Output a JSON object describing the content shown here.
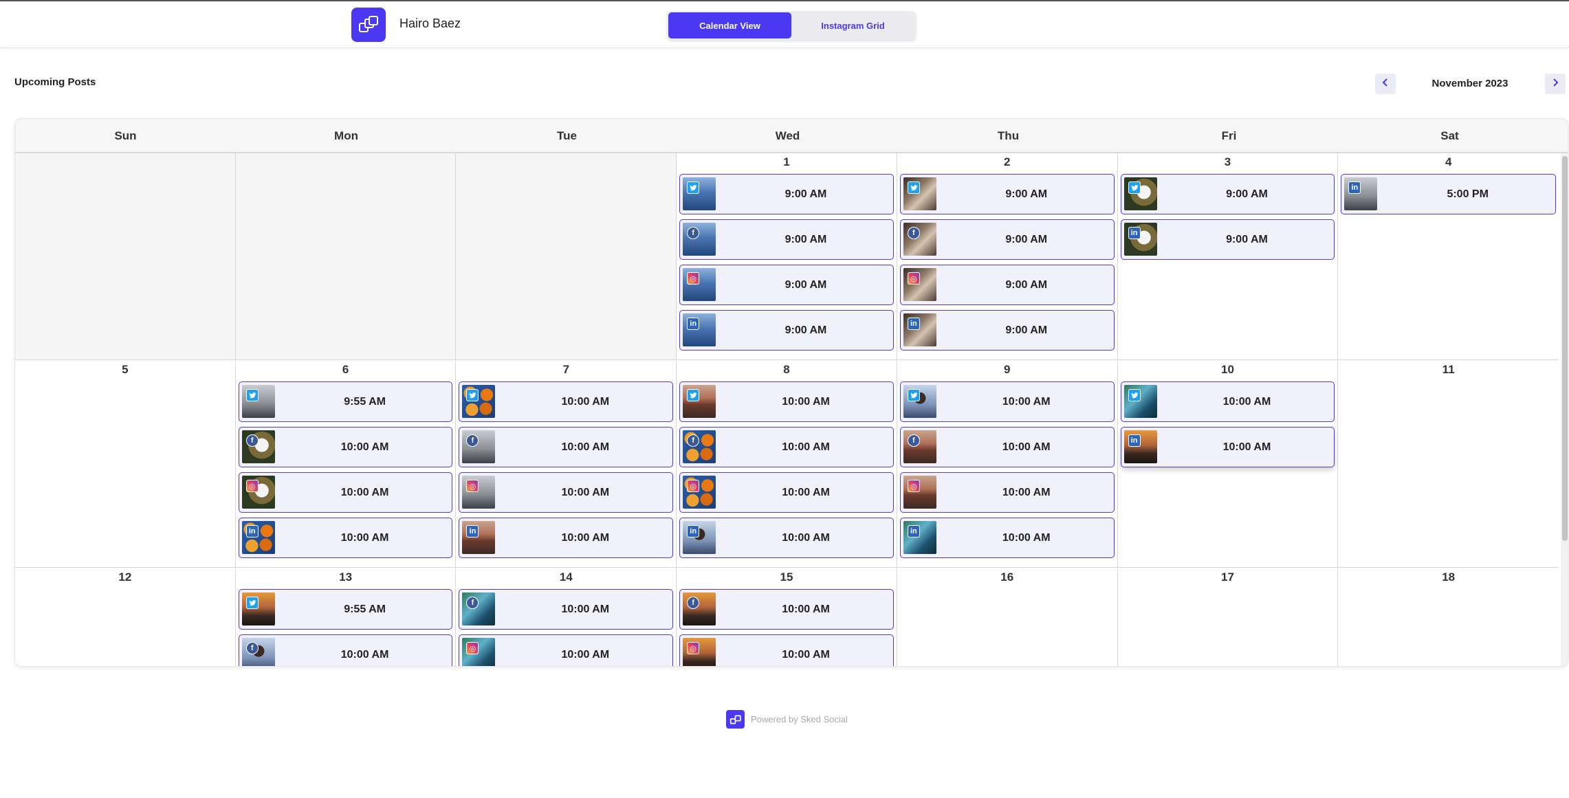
{
  "header": {
    "brand_name": "Hairo Baez",
    "views": [
      {
        "label": "Calendar View",
        "active": true
      },
      {
        "label": "Instagram Grid",
        "active": false
      }
    ]
  },
  "section_title": "Upcoming Posts",
  "month_label": "November 2023",
  "weekdays": [
    "Sun",
    "Mon",
    "Tue",
    "Wed",
    "Thu",
    "Fri",
    "Sat"
  ],
  "weeks": [
    [
      {
        "day": "",
        "posts": []
      },
      {
        "day": "",
        "posts": []
      },
      {
        "day": "",
        "posts": []
      },
      {
        "day": "1",
        "posts": [
          {
            "network": "twitter",
            "time": "9:00 AM",
            "photo": "ocean"
          },
          {
            "network": "facebook",
            "time": "9:00 AM",
            "photo": "ocean"
          },
          {
            "network": "instagram",
            "time": "9:00 AM",
            "photo": "ocean"
          },
          {
            "network": "linkedin",
            "time": "9:00 AM",
            "photo": "ocean"
          }
        ]
      },
      {
        "day": "2",
        "posts": [
          {
            "network": "twitter",
            "time": "9:00 AM",
            "photo": "cafe"
          },
          {
            "network": "facebook",
            "time": "9:00 AM",
            "photo": "cafe"
          },
          {
            "network": "instagram",
            "time": "9:00 AM",
            "photo": "cafe"
          },
          {
            "network": "linkedin",
            "time": "9:00 AM",
            "photo": "cafe"
          }
        ]
      },
      {
        "day": "3",
        "posts": [
          {
            "network": "twitter",
            "time": "9:00 AM",
            "photo": "eagle"
          },
          {
            "network": "linkedin",
            "time": "9:00 AM",
            "photo": "eagle"
          }
        ]
      },
      {
        "day": "4",
        "posts": [
          {
            "network": "linkedin",
            "time": "5:00 PM",
            "photo": "misty"
          }
        ]
      }
    ],
    [
      {
        "day": "5",
        "posts": []
      },
      {
        "day": "6",
        "posts": [
          {
            "network": "twitter",
            "time": "9:55 AM",
            "photo": "misty"
          },
          {
            "network": "facebook",
            "time": "10:00 AM",
            "photo": "eagle"
          },
          {
            "network": "instagram",
            "time": "10:00 AM",
            "photo": "eagle"
          },
          {
            "network": "linkedin",
            "time": "10:00 AM",
            "photo": "oranges"
          }
        ]
      },
      {
        "day": "7",
        "posts": [
          {
            "network": "twitter",
            "time": "10:00 AM",
            "photo": "oranges"
          },
          {
            "network": "facebook",
            "time": "10:00 AM",
            "photo": "misty"
          },
          {
            "network": "instagram",
            "time": "10:00 AM",
            "photo": "misty"
          },
          {
            "network": "linkedin",
            "time": "10:00 AM",
            "photo": "road"
          }
        ]
      },
      {
        "day": "8",
        "posts": [
          {
            "network": "twitter",
            "time": "10:00 AM",
            "photo": "road"
          },
          {
            "network": "facebook",
            "time": "10:00 AM",
            "photo": "oranges"
          },
          {
            "network": "instagram",
            "time": "10:00 AM",
            "photo": "oranges"
          },
          {
            "network": "linkedin",
            "time": "10:00 AM",
            "photo": "person"
          }
        ]
      },
      {
        "day": "9",
        "posts": [
          {
            "network": "twitter",
            "time": "10:00 AM",
            "photo": "person"
          },
          {
            "network": "facebook",
            "time": "10:00 AM",
            "photo": "road"
          },
          {
            "network": "instagram",
            "time": "10:00 AM",
            "photo": "road"
          },
          {
            "network": "linkedin",
            "time": "10:00 AM",
            "photo": "cliff"
          }
        ]
      },
      {
        "day": "10",
        "posts": [
          {
            "network": "twitter",
            "time": "10:00 AM",
            "photo": "cliff"
          },
          {
            "network": "linkedin",
            "time": "10:00 AM",
            "photo": "sunset",
            "highlighted": true
          }
        ]
      },
      {
        "day": "11",
        "posts": []
      }
    ],
    [
      {
        "day": "12",
        "posts": []
      },
      {
        "day": "13",
        "posts": [
          {
            "network": "twitter",
            "time": "9:55 AM",
            "photo": "sunset"
          },
          {
            "network": "facebook",
            "time": "10:00 AM",
            "photo": "person"
          }
        ]
      },
      {
        "day": "14",
        "posts": [
          {
            "network": "facebook",
            "time": "10:00 AM",
            "photo": "cliff"
          },
          {
            "network": "instagram",
            "time": "10:00 AM",
            "photo": "cliff"
          }
        ]
      },
      {
        "day": "15",
        "posts": [
          {
            "network": "facebook",
            "time": "10:00 AM",
            "photo": "sunset"
          },
          {
            "network": "instagram",
            "time": "10:00 AM",
            "photo": "sunset"
          }
        ]
      },
      {
        "day": "16",
        "posts": []
      },
      {
        "day": "17",
        "posts": []
      },
      {
        "day": "18",
        "posts": []
      }
    ]
  ],
  "footer": {
    "text": "Powered by Sked Social"
  },
  "colors": {
    "accent": "#4a38f2",
    "post_bg": "#f1f1fb",
    "empty_cell": "#f5f5f5"
  }
}
